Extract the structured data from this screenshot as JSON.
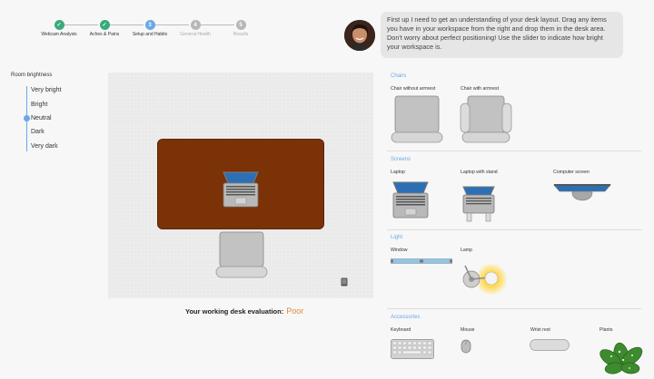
{
  "stepper": {
    "steps": [
      {
        "label": "Webcam Analysis",
        "state": "done",
        "symbol": "✓"
      },
      {
        "label": "Aches & Pains",
        "state": "done",
        "symbol": "✓"
      },
      {
        "label": "Setup and Habits",
        "state": "active",
        "symbol": "3"
      },
      {
        "label": "General Health",
        "state": "todo",
        "symbol": "4"
      },
      {
        "label": "Results",
        "state": "todo",
        "symbol": "5"
      }
    ]
  },
  "chat": {
    "message": "First up I need to get an understanding of your desk layout. Drag any items you have in your workspace from the right and drop them in the desk area. Don't worry about perfect positioning! Use the slider to indicate how bright your workspace is."
  },
  "brightness": {
    "title": "Room brightness",
    "options": [
      "Very bright",
      "Bright",
      "Neutral",
      "Dark",
      "Very dark"
    ],
    "selected": "Neutral"
  },
  "evaluation": {
    "label": "Your working desk evaluation:",
    "value": "Poor",
    "value_color": "#e38b3a"
  },
  "sections": {
    "chairs": {
      "title": "Chairs",
      "items": [
        "Chair without armrest",
        "Chair with armrest"
      ]
    },
    "screens": {
      "title": "Screens",
      "items": [
        "Laptop",
        "Laptop with stand",
        "Computer screen"
      ]
    },
    "light": {
      "title": "Light",
      "items": [
        "Window",
        "Lamp"
      ]
    },
    "accessories": {
      "title": "Accessories",
      "items": [
        "Keyboard",
        "Mouse",
        "Wrist rest",
        "Plants"
      ]
    }
  },
  "colors": {
    "accent": "#6aa8e6",
    "done": "#3aaa7c",
    "desk": "#7a3206"
  }
}
